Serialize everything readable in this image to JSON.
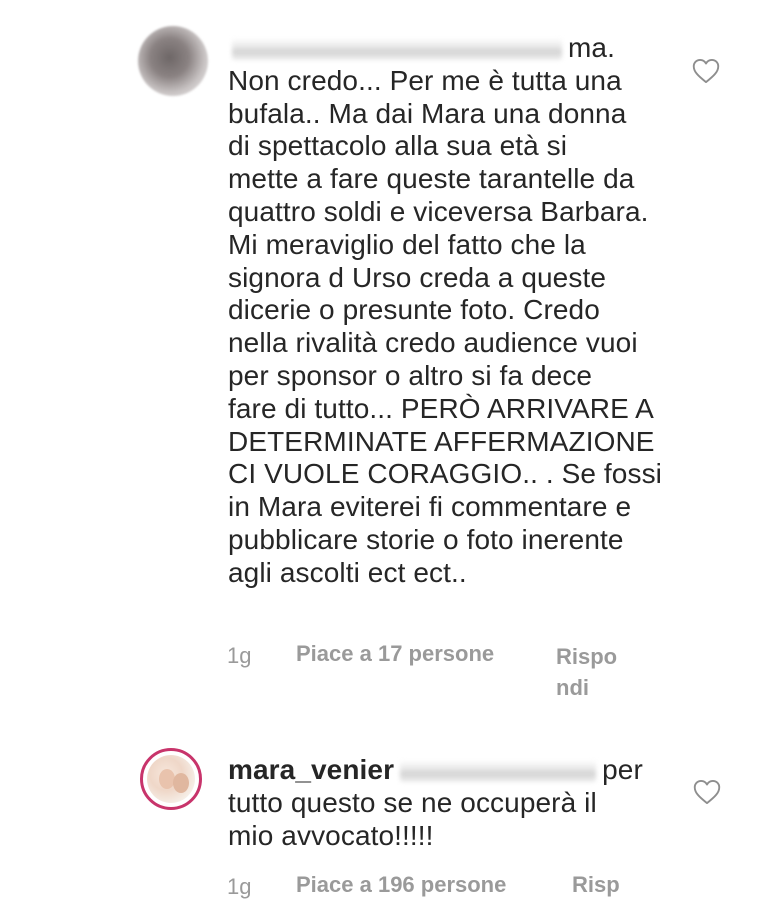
{
  "comments": [
    {
      "username_suffix": "ma.",
      "text_lines": [
        "Non credo... Per me è tutta una",
        "bufala.. Ma dai Mara una donna",
        "di spettacolo alla sua età si",
        "mette a fare queste tarantelle da",
        "quattro soldi e viceversa Barbara.",
        "Mi meraviglio del fatto che la",
        "signora d Urso creda a queste",
        "dicerie o presunte foto. Credo",
        "nella rivalità credo audience vuoi",
        "per sponsor o altro si fa dece",
        "fare di tutto... PERÒ ARRIVARE A",
        "DETERMINATE AFFERMAZIONE",
        "CI VUOLE  CORAGGIO.. . Se fossi",
        "in Mara eviterei fi commentare e",
        "pubblicare storie o foto inerente",
        "agli ascolti ect ect.."
      ],
      "time": "1g",
      "likes": "Piace a 17 persone",
      "reply": "Rispo ndi",
      "avatar": "blurred-avatar"
    },
    {
      "username": "mara_venier",
      "after_mention": "per",
      "text_lines": [
        "tutto questo se ne occuperà il",
        "mio avvocato!!!!!"
      ],
      "time": "1g",
      "likes": "Piace a 196 persone",
      "reply": "Risp",
      "avatar": "mara-venier-avatar"
    }
  ],
  "icons": {
    "like": "heart-outline-icon"
  },
  "colors": {
    "text": "#262626",
    "meta": "#9a9a9a",
    "avatar_ring": "#c8346b"
  }
}
